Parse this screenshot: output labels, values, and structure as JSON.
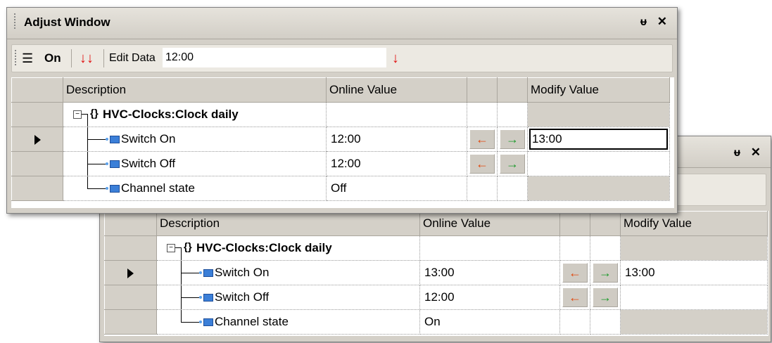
{
  "window1": {
    "title": "Adjust Window",
    "pin_glyph": "ᵾ",
    "close_glyph": "✕",
    "toolbar": {
      "list_icon": "☰",
      "on_label": "On",
      "down_arrows": "↓↓",
      "edit_data_label": "Edit Data",
      "edit_data_value": "12:00",
      "apply_arrow": "↓"
    },
    "headers": {
      "description": "Description",
      "online_value": "Online Value",
      "modify_value": "Modify Value"
    },
    "group": "HVC-Clocks:Clock daily",
    "rows": [
      {
        "label": "Switch On",
        "online": "12:00",
        "modify": "13:00"
      },
      {
        "label": "Switch Off",
        "online": "12:00",
        "modify": ""
      },
      {
        "label": "Channel state",
        "online": "Off",
        "modify": ""
      }
    ]
  },
  "window2": {
    "pin_glyph": "ᵾ",
    "close_glyph": "✕",
    "headers": {
      "description": "Description",
      "online_value": "Online Value",
      "modify_value": "Modify Value"
    },
    "group": "HVC-Clocks:Clock daily",
    "rows": [
      {
        "label": "Switch On",
        "online": "13:00",
        "modify": "13:00"
      },
      {
        "label": "Switch Off",
        "online": "12:00",
        "modify": ""
      },
      {
        "label": "Channel state",
        "online": "On",
        "modify": ""
      }
    ]
  },
  "icons": {
    "arrow_left": "←",
    "arrow_right": "→",
    "expand": "−",
    "brace": "{}"
  },
  "colors": {
    "arrow_left": "#e04a10",
    "arrow_right": "#1a9a2a",
    "apply_arrow": "#e01010",
    "item_icon": "#3b7fd8"
  }
}
